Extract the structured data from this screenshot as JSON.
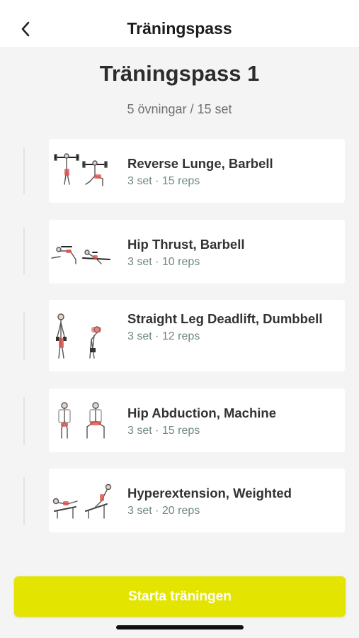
{
  "header": {
    "title": "Träningspass",
    "back_icon": "chevron-left-icon"
  },
  "workout": {
    "title": "Träningspass 1",
    "summary": "5 övningar / 15 set"
  },
  "exercises": [
    {
      "name": "Reverse Lunge, Barbell",
      "detail": "3 set · 15 reps",
      "icon": "reverse-lunge-illustration"
    },
    {
      "name": "Hip Thrust, Barbell",
      "detail": "3 set · 10 reps",
      "icon": "hip-thrust-illustration"
    },
    {
      "name": "Straight Leg Deadlift, Dumbbell",
      "detail": "3 set · 12 reps",
      "icon": "deadlift-illustration"
    },
    {
      "name": "Hip Abduction, Machine",
      "detail": "3 set · 15 reps",
      "icon": "hip-abduction-illustration"
    },
    {
      "name": "Hyperextension, Weighted",
      "detail": "3 set · 20 reps",
      "icon": "hyperextension-illustration"
    }
  ],
  "start_button": {
    "label": "Starta träningen"
  },
  "colors": {
    "accent": "#e3e400",
    "detail_text": "#6f8a7a",
    "muscle_highlight": "#d9534f"
  }
}
